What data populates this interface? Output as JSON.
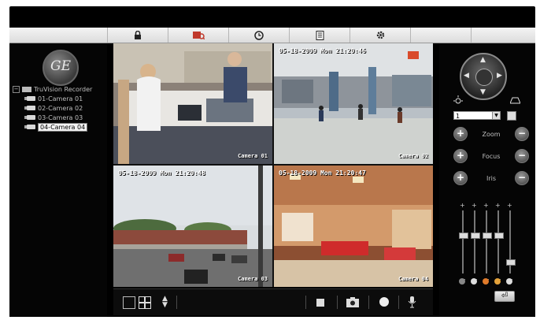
{
  "tree": {
    "root": "TruVision Recorder",
    "toggle": "−",
    "cameras": [
      "01-Camera 01",
      "02-Camera 02",
      "03-Camera 03",
      "04-Camera 04"
    ]
  },
  "logo_text": "GE",
  "tiles": [
    {
      "timestamp": "",
      "label": "Camera 01"
    },
    {
      "timestamp": "05-18-2009 Mon 21:20:46",
      "label": "Camera 02"
    },
    {
      "timestamp": "05-18-2009 Mon 21:20:48",
      "label": "Camera 03"
    },
    {
      "timestamp": "05-18-2009 Mon 21:20:47",
      "label": "Camera 04"
    }
  ],
  "ptz": {
    "preset_value": "1",
    "zoom_label": "Zoom",
    "focus_label": "Focus",
    "iris_label": "Iris",
    "plus": "+",
    "minus": "−"
  },
  "toolbar_icons": [
    "lock-icon",
    "playback-icon",
    "clock-icon",
    "log-icon",
    "settings-icon"
  ],
  "colors": {
    "frame": "#000000",
    "toolbar": "#e6e6e6",
    "accent_red": "#c0392b",
    "selection": "#f2f2f2"
  }
}
